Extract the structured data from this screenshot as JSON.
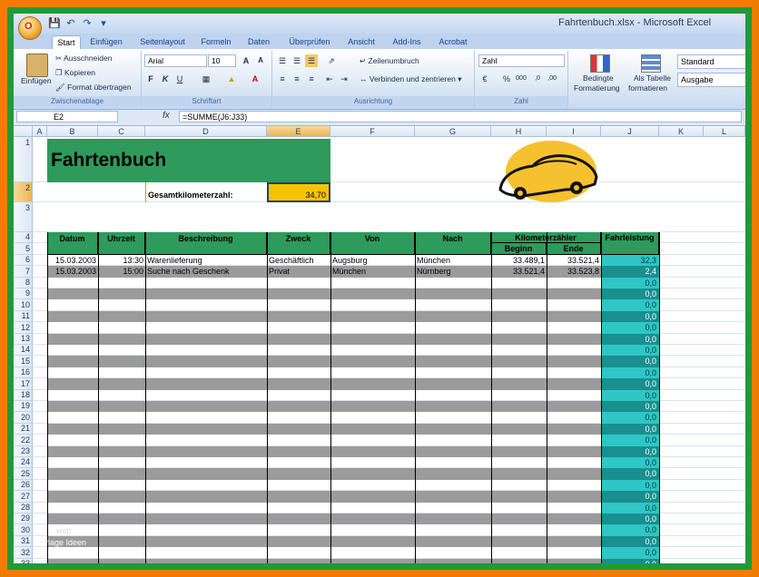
{
  "window": {
    "title": "Fahrtenbuch.xlsx - Microsoft Excel",
    "office_button_label": "O"
  },
  "ribbon": {
    "tabs": [
      "Start",
      "Einfügen",
      "Seitenlayout",
      "Formeln",
      "Daten",
      "Überprüfen",
      "Ansicht",
      "Add-Ins",
      "Acrobat"
    ],
    "active_tab": "Start",
    "clipboard": {
      "paste": "Einfügen",
      "cut": "Ausschneiden",
      "copy": "Kopieren",
      "format_painter": "Format übertragen",
      "label": "Zwischenablage"
    },
    "font": {
      "name": "Arial",
      "size": "10",
      "label": "Schriftart"
    },
    "alignment": {
      "wrap": "Zeilenumbruch",
      "merge": "Verbinden und zentrieren",
      "label": "Ausrichtung"
    },
    "number": {
      "format": "Zahl",
      "label": "Zahl"
    },
    "styles": {
      "conditional": "Bedingte",
      "conditional2": "Formatierung",
      "as_table": "Als Tabelle",
      "as_table2": "formatieren",
      "standard": "Standard",
      "output": "Ausgabe"
    }
  },
  "formula_bar": {
    "name_box": "E2",
    "fx": "fx",
    "formula": "=SUMME(J6:J33)"
  },
  "columns": [
    "A",
    "B",
    "C",
    "D",
    "E",
    "F",
    "G",
    "H",
    "I",
    "J",
    "K",
    "L"
  ],
  "sheet": {
    "title": "Fahrtenbuch",
    "total_label": "Gesamtkilometerzahl:",
    "total_value": "34,70",
    "headers": {
      "datum": "Datum",
      "uhrzeit": "Uhrzeit",
      "beschreibung": "Beschreibung",
      "zweck": "Zweck",
      "von": "Von",
      "nach": "Nach",
      "km": "Kilometerzähler",
      "beginn": "Beginn",
      "ende": "Ende",
      "fahrleistung": "Fahrleistung"
    },
    "rows": [
      {
        "row": "6",
        "datum": "15.03.2003",
        "uhrzeit": "13:30",
        "beschreibung": "Warenlieferung",
        "zweck": "Geschäftlich",
        "von": "Augsburg",
        "nach": "München",
        "beginn": "33.489,1",
        "ende": "33.521,4",
        "fahrleistung": "32,3"
      },
      {
        "row": "7",
        "datum": "15.03.2003",
        "uhrzeit": "15:00",
        "beschreibung": "Suche nach Geschenk",
        "zweck": "Privat",
        "von": "München",
        "nach": "Nürnberg",
        "beginn": "33.521,4",
        "ende": "33.523,8",
        "fahrleistung": "2,4"
      }
    ],
    "empty_value": "0,0",
    "watermark": "web",
    "watermark2": "rlage Ideen"
  }
}
